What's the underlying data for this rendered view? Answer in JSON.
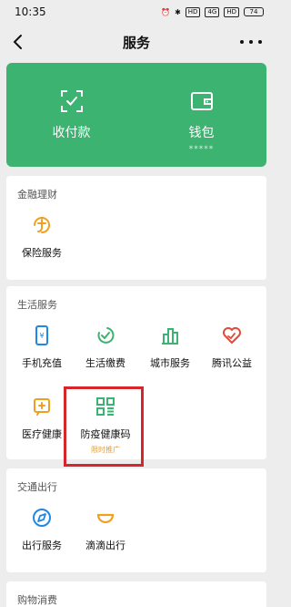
{
  "status": {
    "time": "10:35",
    "indicators": [
      "HD",
      "4G",
      "HD"
    ],
    "battery": "74"
  },
  "nav": {
    "title": "服务"
  },
  "pay_card": {
    "left": {
      "label": "收付款",
      "icon": "scan-pay-icon"
    },
    "right": {
      "label": "钱包",
      "sub": "*****",
      "icon": "wallet-icon"
    },
    "color": "#3cb371"
  },
  "sections": {
    "finance": {
      "title": "金融理财",
      "items": [
        {
          "label": "保险服务",
          "icon": "insurance-icon"
        }
      ]
    },
    "life": {
      "title": "生活服务",
      "items": [
        {
          "label": "手机充值",
          "icon": "phone-recharge-icon"
        },
        {
          "label": "生活缴费",
          "icon": "utility-pay-icon"
        },
        {
          "label": "城市服务",
          "icon": "city-service-icon"
        },
        {
          "label": "腾讯公益",
          "icon": "charity-icon"
        },
        {
          "label": "医疗健康",
          "icon": "medical-icon"
        },
        {
          "label": "防疫健康码",
          "tag": "限时推广",
          "icon": "health-code-icon"
        }
      ]
    },
    "transport": {
      "title": "交通出行",
      "items": [
        {
          "label": "出行服务",
          "icon": "travel-icon"
        },
        {
          "label": "滴滴出行",
          "icon": "didi-icon"
        }
      ]
    },
    "shopping": {
      "title": "购物消费"
    }
  },
  "colors": {
    "accent": "#3cb371",
    "highlight": "#d4262b",
    "icon_blue": "#1e88e5",
    "icon_orange": "#f0a020",
    "icon_red": "#e04a3a",
    "icon_green": "#3cb371"
  }
}
